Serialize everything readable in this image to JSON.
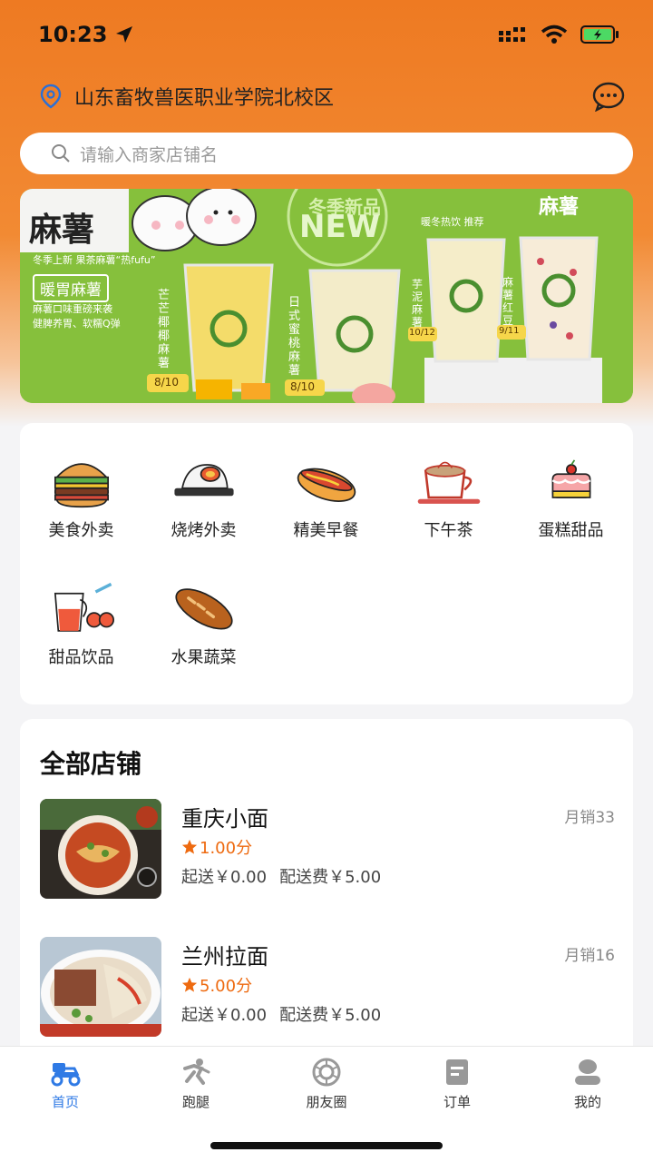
{
  "status_bar": {
    "time": "10:23"
  },
  "header": {
    "location": "山东畜牧兽医职业学院北校区",
    "icons": {
      "location": "location-pin-icon",
      "message": "chat-bubble-icon"
    }
  },
  "search": {
    "placeholder": "请输入商家店铺名"
  },
  "banner": {
    "headline_left": "麻薯",
    "badge_top": "冬季新品",
    "badge_new": "NEW",
    "headline_right": "麻薯",
    "subtitle_left": "冬季上新  果茶麻薯“热fufu”",
    "tag": "暖胃麻薯",
    "desc_line1": "麻薯口味重磅来袭",
    "desc_line2": "健脾养胃、软糯Q弹",
    "right_sub": "暖冬热饮  推荐",
    "drinks": [
      {
        "name": "芒芒椰椰麻薯",
        "price": "8/10"
      },
      {
        "name": "日式蜜桃麻薯",
        "price": "8/10"
      },
      {
        "name": "芋泥麻薯",
        "price": "10/12"
      },
      {
        "name": "麻薯红豆",
        "price": "9/11"
      }
    ]
  },
  "categories": [
    {
      "label": "美食外卖",
      "icon": "burger-icon"
    },
    {
      "label": "烧烤外卖",
      "icon": "rice-bowl-icon"
    },
    {
      "label": "精美早餐",
      "icon": "hotdog-icon"
    },
    {
      "label": "下午茶",
      "icon": "coffee-cup-icon"
    },
    {
      "label": "蛋糕甜品",
      "icon": "cake-icon"
    },
    {
      "label": "甜品饮品",
      "icon": "drinks-icon"
    },
    {
      "label": "水果蔬菜",
      "icon": "bread-icon"
    }
  ],
  "shops": {
    "title": "全部店铺",
    "items": [
      {
        "name": "重庆小面",
        "sales": "月销33",
        "rating": "1.00分",
        "min_order": "起送￥0.00",
        "delivery_fee": "配送费￥5.00"
      },
      {
        "name": "兰州拉面",
        "sales": "月销16",
        "rating": "5.00分",
        "min_order": "起送￥0.00",
        "delivery_fee": "配送费￥5.00"
      }
    ]
  },
  "tabs": [
    {
      "label": "首页",
      "icon": "home-scooter-icon",
      "active": true
    },
    {
      "label": "跑腿",
      "icon": "runner-icon",
      "active": false
    },
    {
      "label": "朋友圈",
      "icon": "moments-icon",
      "active": false
    },
    {
      "label": "订单",
      "icon": "order-icon",
      "active": false
    },
    {
      "label": "我的",
      "icon": "profile-icon",
      "active": false
    }
  ],
  "colors": {
    "accent": "#ee7a22",
    "rating": "#ee6a10",
    "tab_active": "#2f7ae5",
    "banner_green": "#7dbb37"
  }
}
